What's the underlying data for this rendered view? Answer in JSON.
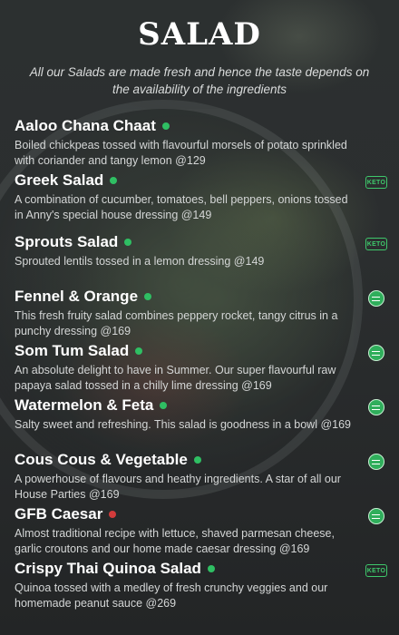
{
  "header": {
    "title": "SALAD",
    "subtitle": "All our Salads are made fresh and hence the taste depends on the availability of the ingredients"
  },
  "colors": {
    "veg_dot": "#2fbf63",
    "nonveg_dot": "#d23b3b",
    "badge_green": "#3ec86b"
  },
  "items": [
    {
      "name": "Aaloo Chana Chaat",
      "description": "Boiled chickpeas tossed with flavourful morsels of potato sprinkled with coriander and tangy lemon @129",
      "dot": "veg",
      "badge": ""
    },
    {
      "name": "Greek Salad",
      "description": "A combination of cucumber, tomatoes, bell peppers, onions tossed in Anny's special house dressing @149",
      "dot": "veg",
      "badge": "keto",
      "badge_text": "KETO"
    },
    {
      "name": "Sprouts Salad",
      "description": "Sprouted lentils tossed in a lemon dressing @149",
      "dot": "veg",
      "badge": "keto",
      "badge_text": "KETO"
    },
    {
      "name": "Fennel & Orange",
      "description": "This fresh fruity salad combines peppery rocket, tangy citrus in a punchy dressing @169",
      "dot": "veg",
      "badge": "vegan-icon"
    },
    {
      "name": "Som Tum Salad",
      "description": "An absolute delight to have in Summer. Our super flavourful raw papaya salad tossed in a chilly lime dressing @169",
      "dot": "veg",
      "badge": "vegan-icon"
    },
    {
      "name": "Watermelon & Feta",
      "description": "Salty sweet and refreshing. This salad is goodness in a bowl @169",
      "dot": "veg",
      "badge": "vegan-icon"
    },
    {
      "name": "Cous Cous & Vegetable",
      "description": "A powerhouse of flavours and heathy ingredients. A star of all our House Parties @169",
      "dot": "veg",
      "badge": "vegan-icon"
    },
    {
      "name": "GFB Caesar",
      "description": "Almost traditional recipe with lettuce, shaved parmesan cheese, garlic croutons and our home made caesar dressing @169",
      "dot": "nonveg",
      "badge": "vegan-icon"
    },
    {
      "name": "Crispy Thai Quinoa Salad",
      "description": "Quinoa tossed with a medley of fresh crunchy veggies and our homemade peanut sauce @269",
      "dot": "veg",
      "badge": "keto",
      "badge_text": "KETO"
    }
  ]
}
